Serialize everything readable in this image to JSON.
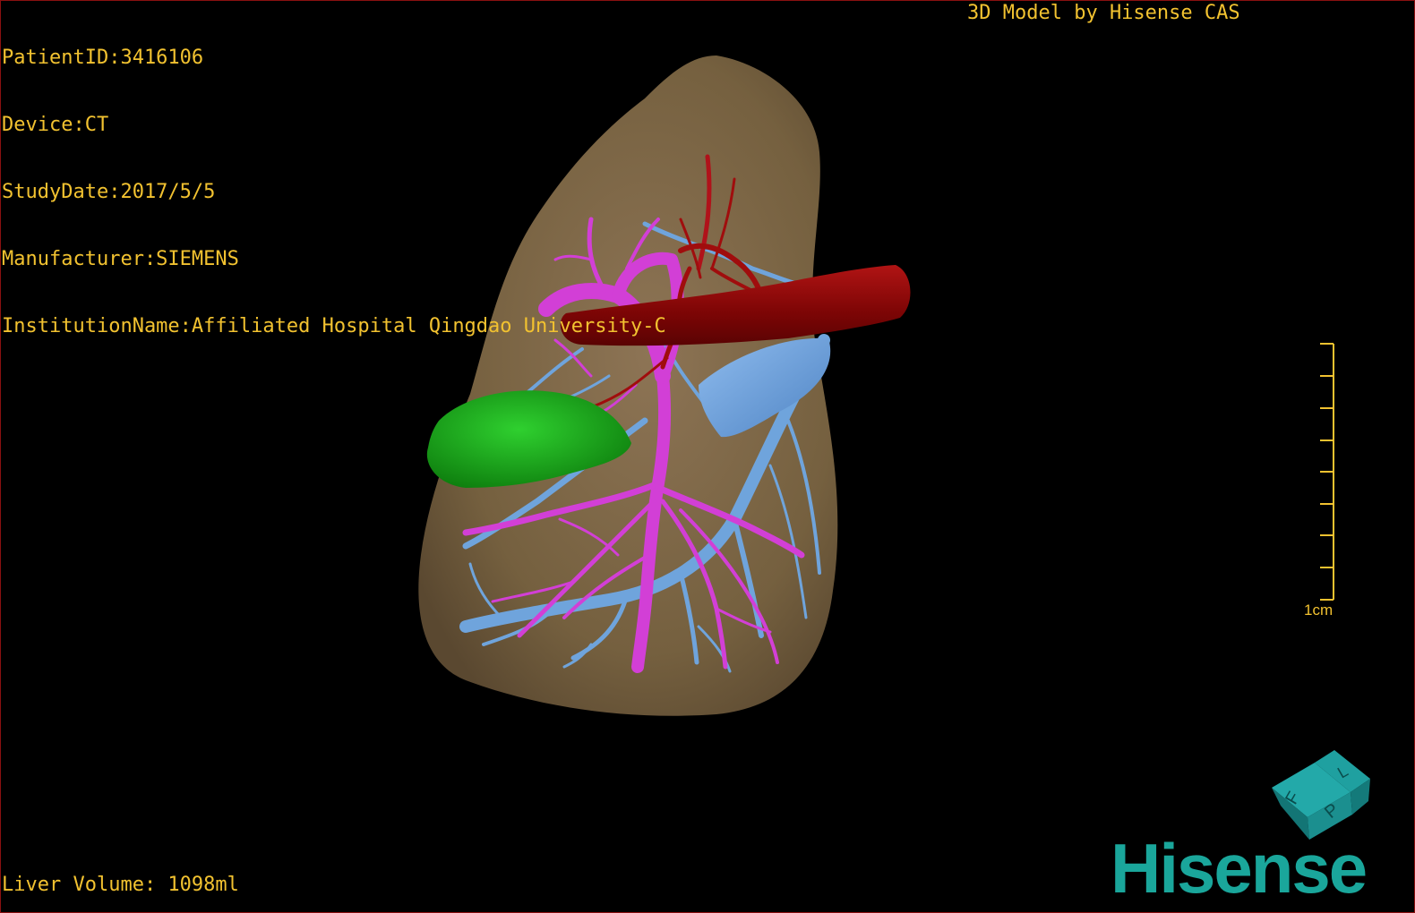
{
  "overlay": {
    "patient_id": "PatientID:3416106",
    "device": "Device:CT",
    "study_date": "StudyDate:2017/5/5",
    "manufacturer": "Manufacturer:SIEMENS",
    "institution": "InstitutionName:Affiliated Hospital Qingdao University-C"
  },
  "credit": "3D Model by Hisense CAS",
  "liver_volume": "Liver Volume: 1098ml",
  "scale_bar": {
    "label": "1cm",
    "tick_count": 9
  },
  "orientation_cube": {
    "face_left": "F",
    "face_right": "P",
    "face_top": "L",
    "color": "#1a8a8a"
  },
  "brand": "Hisense",
  "colors": {
    "text": "#f2c230",
    "liver": "#7a6244",
    "portal_vein": "#d23fd6",
    "hepatic_vein": "#6fa4dc",
    "artery": "#8b0808",
    "tumor": "#12a012",
    "brand": "#1aa69b"
  }
}
